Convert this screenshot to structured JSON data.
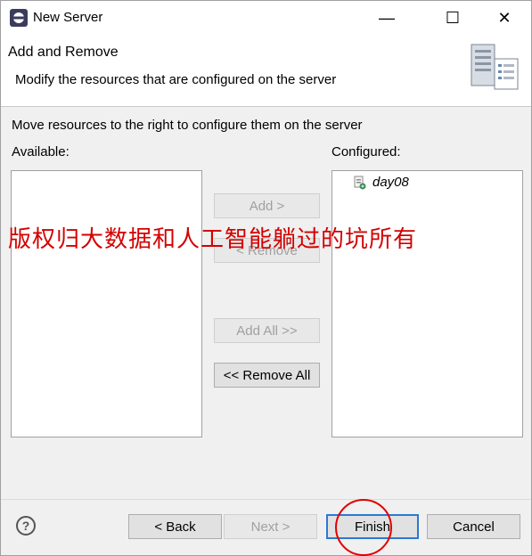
{
  "window": {
    "title": "New Server",
    "controls": {
      "minimize": "—",
      "maximize": "☐",
      "close": "✕"
    }
  },
  "header": {
    "title": "Add and Remove",
    "description": "Modify the resources that are configured on the server"
  },
  "instructions": "Move resources to the right to configure them on the server",
  "available": {
    "label": "Available:",
    "items": []
  },
  "configured": {
    "label": "Configured:",
    "items": [
      "day08"
    ]
  },
  "buttons": {
    "add": "Add >",
    "remove": "< Remove",
    "add_all": "Add All >>",
    "remove_all": "<< Remove All"
  },
  "watermark": "版权归大数据和人工智能躺过的坑所有",
  "footer": {
    "help": "?",
    "back": "< Back",
    "next": "Next >",
    "finish": "Finish",
    "cancel": "Cancel"
  },
  "colors": {
    "accent": "#2b78d4",
    "watermark": "#d40000",
    "annotation_circle": "#e00000"
  }
}
